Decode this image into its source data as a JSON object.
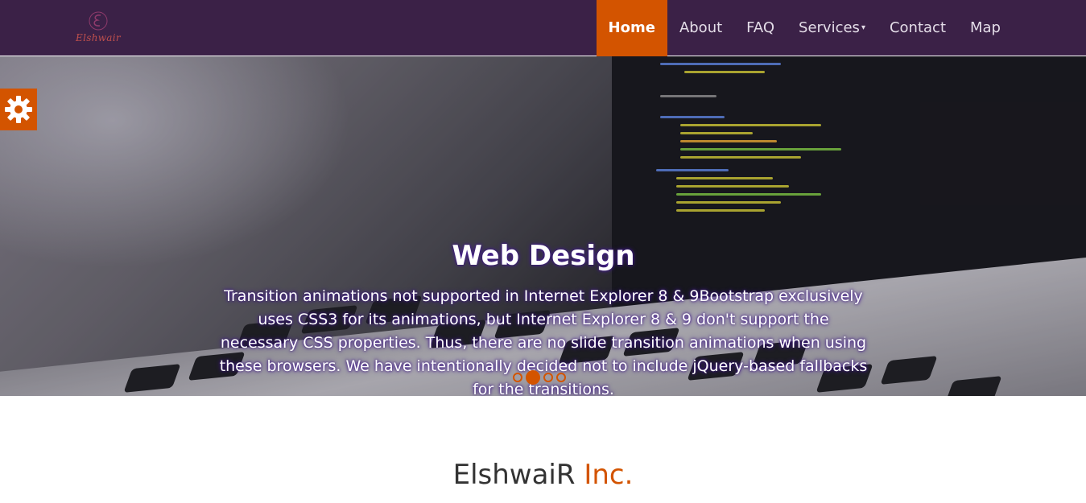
{
  "brand": {
    "logo_text": "Elshwair",
    "logo_icon": "script-e-logo-icon"
  },
  "nav": {
    "items": [
      {
        "label": "Home",
        "active": true
      },
      {
        "label": "About"
      },
      {
        "label": "FAQ"
      },
      {
        "label": "Services",
        "has_dropdown": true
      },
      {
        "label": "Contact"
      },
      {
        "label": "Map"
      }
    ]
  },
  "settings": {
    "icon": "gear-icon"
  },
  "carousel": {
    "title": "Web Design",
    "text": "Transition animations not supported in Internet Explorer 8 & 9Bootstrap exclusively uses CSS3 for its animations, but Internet Explorer 8 & 9 don't support the necessary CSS properties. Thus, there are no slide transition animations when using these browsers. We have intentionally decided not to include jQuery-based fallbacks for the transitions.",
    "slide_count": 4,
    "active_slide": 2
  },
  "company": {
    "name": "ElshwaiR",
    "suffix": "Inc."
  },
  "colors": {
    "nav_bg": "#3b2147",
    "accent": "#d35400",
    "text_dark": "#333333"
  }
}
